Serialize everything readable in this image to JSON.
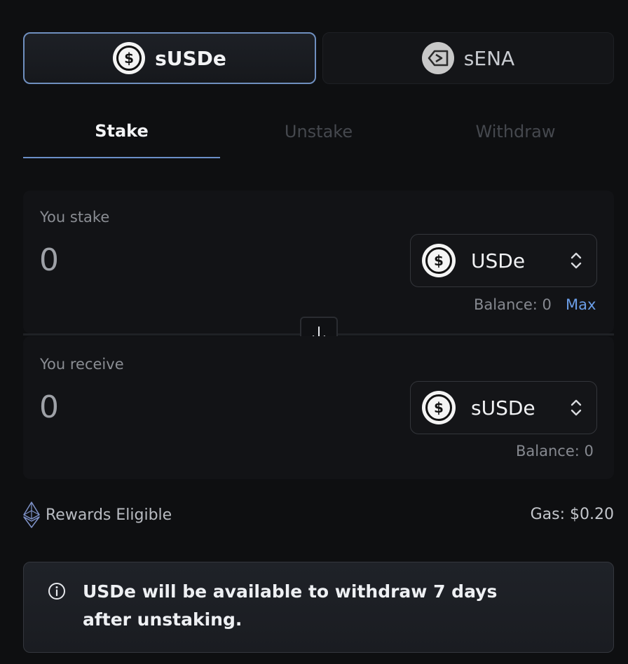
{
  "asset_toggle": {
    "active": "sUSDe",
    "inactive": "sENA"
  },
  "tabs": [
    "Stake",
    "Unstake",
    "Withdraw"
  ],
  "stake_panel": {
    "label": "You stake",
    "amount": "0",
    "token": "USDe",
    "balance_label": "Balance: 0",
    "max_label": "Max"
  },
  "receive_panel": {
    "label": "You receive",
    "amount": "0",
    "token": "sUSDe",
    "balance_label": "Balance: 0"
  },
  "rewards": {
    "label": "Rewards Eligible",
    "icon": "ethereum-icon"
  },
  "gas": {
    "label": "Gas: $0.20"
  },
  "notice": {
    "icon": "info-icon",
    "text": "USDe will be available to withdraw 7 days after unstaking."
  },
  "colors": {
    "background": "#0e0f11",
    "accent": "#6b8fc8",
    "max_link": "#6b9ee8"
  }
}
